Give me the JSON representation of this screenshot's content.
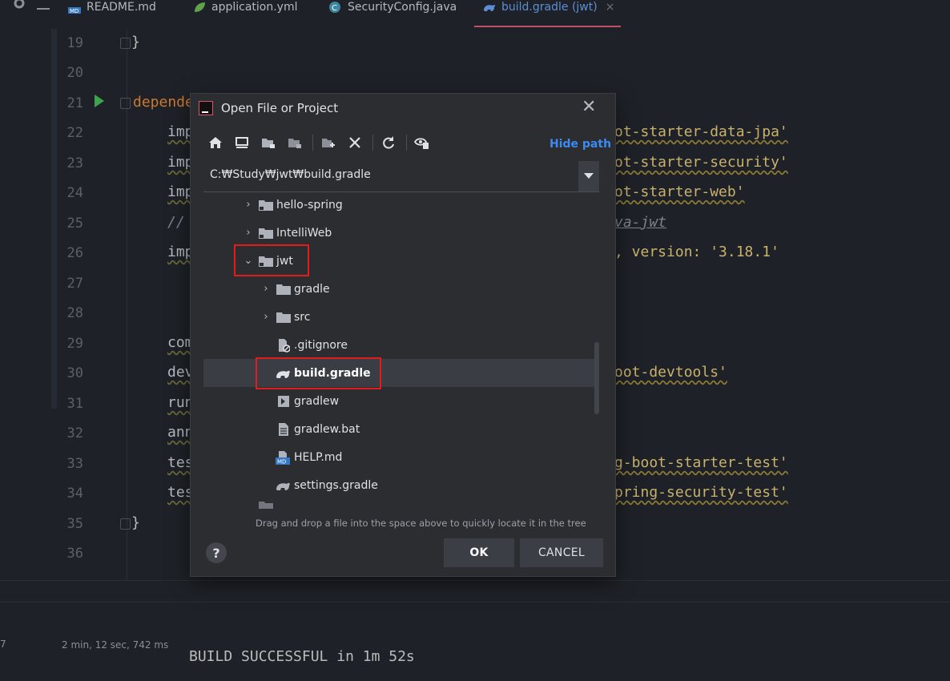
{
  "tabs": [
    {
      "label": "README.md",
      "icon": "markdown-icon"
    },
    {
      "label": "application.yml",
      "icon": "yaml-leaf-icon"
    },
    {
      "label": "SecurityConfig.java",
      "icon": "java-class-icon"
    },
    {
      "label": "build.gradle (jwt)",
      "icon": "gradle-icon",
      "active": true,
      "close": "×"
    }
  ],
  "editor": {
    "lines": [
      {
        "num": "19",
        "segments": [
          {
            "t": "}",
            "c": "c-brace"
          }
        ]
      },
      {
        "num": "20",
        "segments": []
      },
      {
        "num": "21",
        "segments": [
          {
            "t": "depende",
            "c": "c-kw"
          }
        ]
      },
      {
        "num": "22",
        "left": "imp",
        "right": "ot-starter-data-jpa'"
      },
      {
        "num": "23",
        "left": "imp",
        "right": "ot-starter-security'"
      },
      {
        "num": "24",
        "left": "imp",
        "right": "ot-starter-web'"
      },
      {
        "num": "25",
        "left": "//",
        "right": "va-jwt",
        "comment": true
      },
      {
        "num": "26",
        "left": "imp",
        "right": ", version: '3.18.1'"
      },
      {
        "num": "27"
      },
      {
        "num": "28"
      },
      {
        "num": "29",
        "left": "com"
      },
      {
        "num": "30",
        "left": "dev",
        "right": "oot-devtools'"
      },
      {
        "num": "31",
        "left": "run"
      },
      {
        "num": "32",
        "left": "ann"
      },
      {
        "num": "33",
        "left": "tes",
        "right": "g-boot-starter-test'"
      },
      {
        "num": "34",
        "left": "tes",
        "right": "pring-security-test'"
      },
      {
        "num": "35",
        "segments": [
          {
            "t": "}",
            "c": "c-brace"
          }
        ]
      },
      {
        "num": "36"
      }
    ]
  },
  "bottom": {
    "left_fragment": "7",
    "build_time": "2 min, 12 sec, 742 ms",
    "build_message": "BUILD SUCCESSFUL in 1m 52s"
  },
  "dialog": {
    "title": "Open File or Project",
    "close": "✕",
    "hide_path": "Hide path",
    "path": "C:₩Study₩jwt₩build.gradle",
    "tree": [
      {
        "label": "hello-spring",
        "indent": 0,
        "arrow": "›",
        "icon": "folder-icon"
      },
      {
        "label": "IntelliWeb",
        "indent": 0,
        "arrow": "›",
        "icon": "folder-icon"
      },
      {
        "label": "jwt",
        "indent": 0,
        "arrow": "⌄",
        "icon": "folder-icon"
      },
      {
        "label": "gradle",
        "indent": 1,
        "arrow": "›",
        "icon": "folder-icon"
      },
      {
        "label": "src",
        "indent": 1,
        "arrow": "›",
        "icon": "folder-icon"
      },
      {
        "label": ".gitignore",
        "indent": 1,
        "arrow": "",
        "icon": "ignore-file-icon"
      },
      {
        "label": "build.gradle",
        "indent": 1,
        "arrow": "",
        "icon": "gradle-icon",
        "selected": true
      },
      {
        "label": "gradlew",
        "indent": 1,
        "arrow": "",
        "icon": "script-icon"
      },
      {
        "label": "gradlew.bat",
        "indent": 1,
        "arrow": "",
        "icon": "text-file-icon"
      },
      {
        "label": "HELP.md",
        "indent": 1,
        "arrow": "",
        "icon": "markdown-icon"
      },
      {
        "label": "settings.gradle",
        "indent": 1,
        "arrow": "",
        "icon": "gradle-icon"
      }
    ],
    "hint": "Drag and drop a file into the space above to quickly locate it in the tree",
    "help": "?",
    "ok": "OK",
    "cancel": "CANCEL"
  },
  "colors": {
    "accent": "#3d8bf0",
    "highlight_box": "#e21b1b",
    "active_tab_underline": "#c0506a",
    "string": "#c9b26c",
    "keyword": "#cc7832"
  }
}
